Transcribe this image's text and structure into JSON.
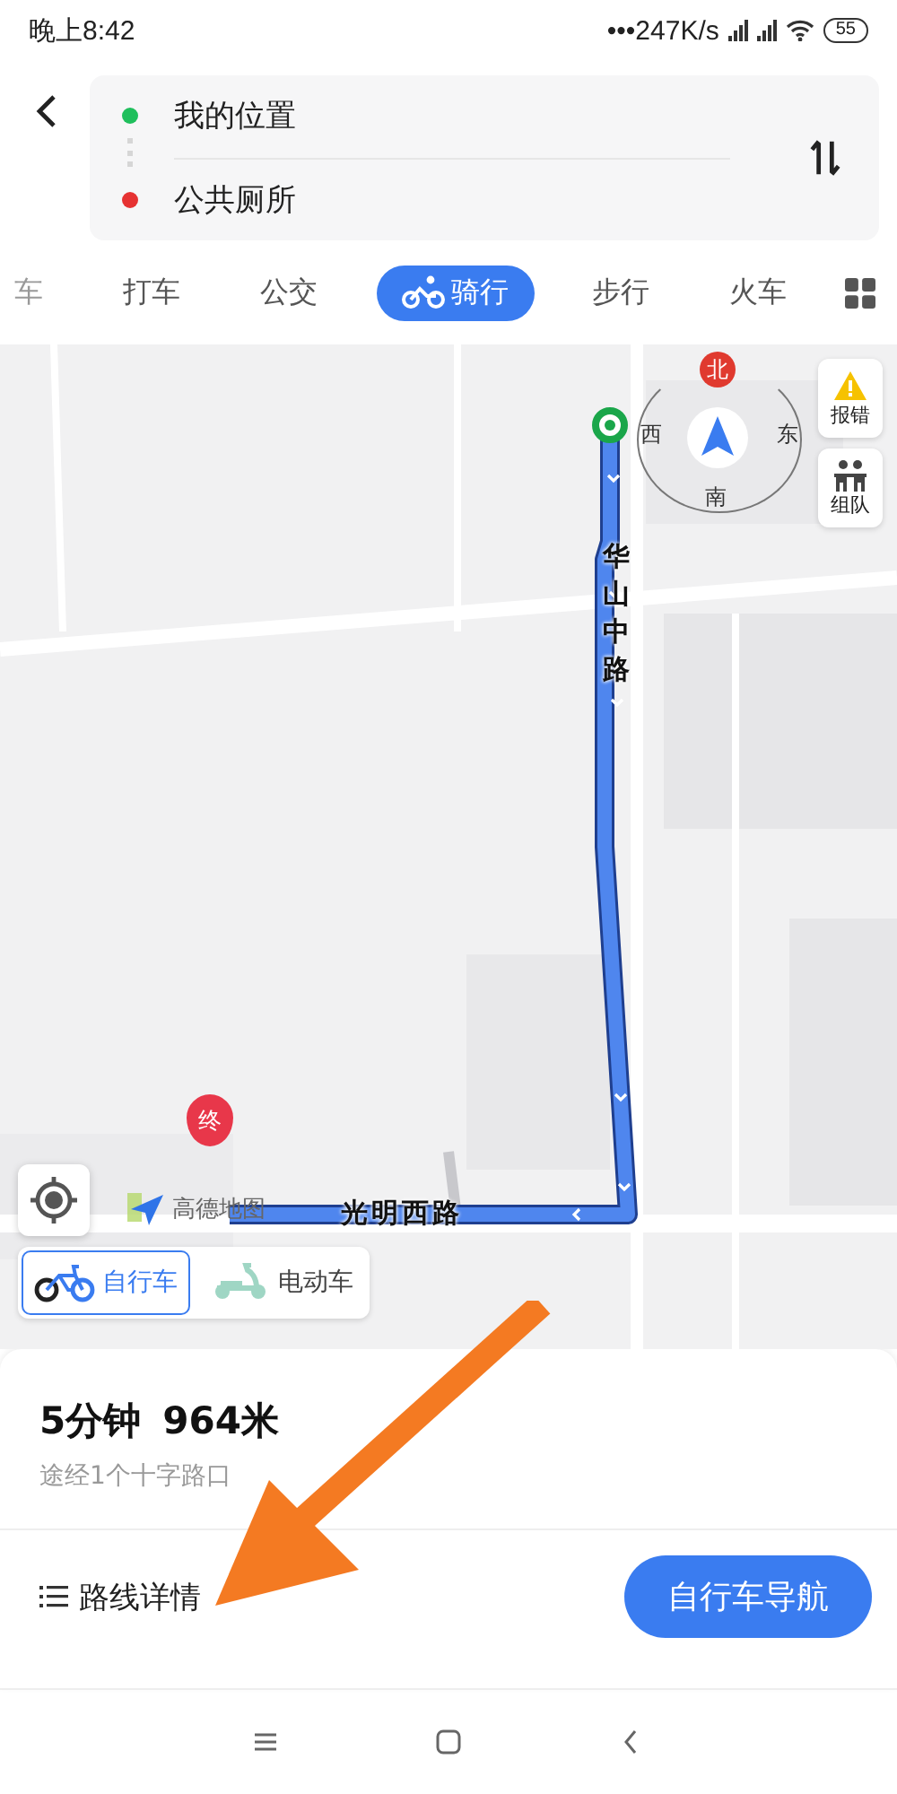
{
  "status_bar": {
    "time": "晚上8:42",
    "network_speed": "•••247K/s",
    "battery": "55"
  },
  "route_input": {
    "origin": "我的位置",
    "destination": "公共厕所"
  },
  "modes": [
    {
      "label": "车",
      "selected": false
    },
    {
      "label": "打车",
      "selected": false
    },
    {
      "label": "公交",
      "selected": false
    },
    {
      "label": "骑行",
      "selected": true,
      "kind": "cycling"
    },
    {
      "label": "步行",
      "selected": false
    },
    {
      "label": "火车",
      "selected": false
    }
  ],
  "map": {
    "compass": {
      "north": "北",
      "west": "西",
      "east": "东",
      "south": "南"
    },
    "side_buttons": [
      {
        "label": "报错",
        "kind": "warning"
      },
      {
        "label": "组队",
        "kind": "team"
      }
    ],
    "route_labels": [
      {
        "text": "华山中路",
        "kind": "vertical"
      },
      {
        "text": "光明西路",
        "kind": "horizontal"
      }
    ],
    "end_marker": "终",
    "logo": "高德地图"
  },
  "vehicles": [
    {
      "label": "自行车",
      "selected": true,
      "kind": "bicycle"
    },
    {
      "label": "电动车",
      "selected": false,
      "kind": "scooter"
    }
  ],
  "summary": {
    "duration": "5分钟",
    "distance": "964米",
    "note": "途经1个十字路口"
  },
  "details_link": "路线详情",
  "navigate_button": "自行车导航"
}
